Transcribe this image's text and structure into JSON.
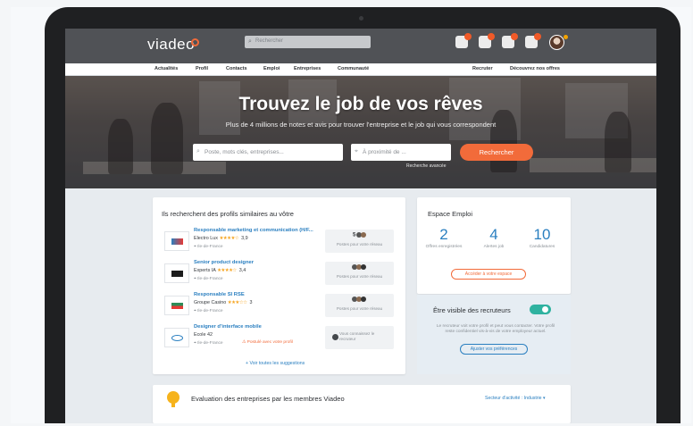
{
  "app": {
    "logo": "viadeo",
    "search_placeholder": "Rechercher"
  },
  "nav": {
    "items": [
      "Actualités",
      "Profil",
      "Contacts",
      "Emploi",
      "Entreprises",
      "Communauté"
    ],
    "right_items": [
      "Recruter",
      "Découvrez nos offres"
    ]
  },
  "hero": {
    "title": "Trouvez le job de vos rêves",
    "subtitle": "Plus de 4 millions de notes et avis pour trouver l'entreprise et le job qui vous correspondent",
    "job_placeholder": "Poste, mots clés, entreprises...",
    "location_placeholder": "À proximité de ...",
    "search_button": "Rechercher",
    "advanced_link": "Recherche avancée"
  },
  "similar": {
    "title": "Ils recherchent des profils similaires au vôtre",
    "rows": [
      {
        "title": "Responsable marketing et communication (H/F...",
        "company": "Electro Lux",
        "stars": "★★★★☆",
        "rating": "3,9",
        "location": "Ile-de-France",
        "box_count": "5",
        "box_text": "Postes pour votre réseau",
        "warning": ""
      },
      {
        "title": "Senior product designer",
        "company": "Experts IA",
        "stars": "★★★★☆",
        "rating": "3,4",
        "location": "Ile-de-France",
        "box_count": "",
        "box_text": "Postes pour votre réseau",
        "warning": ""
      },
      {
        "title": "Responsable SI RSE",
        "company": "Groupe Casino",
        "stars": "★★★☆☆",
        "rating": "3",
        "location": "Ile-de-France",
        "box_count": "",
        "box_text": "Postes pour votre réseau",
        "warning": ""
      },
      {
        "title": "Designer d'interface mobile",
        "company": "Ecole 42",
        "stars": "",
        "rating": "",
        "location": "Ile-de-France",
        "box_count": "",
        "box_text": "Vous connaissez le recruteur",
        "warning": "Postulé avec votre profil"
      }
    ],
    "see_all": "+ Voir toutes les suggestions"
  },
  "espace": {
    "title": "Espace Emploi",
    "stats": [
      {
        "value": "2",
        "label": "Offres enregistrées"
      },
      {
        "value": "4",
        "label": "Alertes job"
      },
      {
        "value": "10",
        "label": "Candidatures"
      }
    ],
    "access_button": "Accéder à votre espace"
  },
  "visibility": {
    "title": "Être visible des recruteurs",
    "text": "Le recruteur voit votre profil et peut vous contacter. Votre profil reste confidentiel vis-à-vis de votre employeur actuel.",
    "button": "Ajuster vos préférences"
  },
  "evaluation": {
    "title": "Evaluation des entreprises par les membres Viadeo",
    "link": "Secteur d'activité : Industrie ▾"
  },
  "colors": {
    "accent": "#f26b3a",
    "link": "#2a7fc0",
    "topbar": "#505256",
    "toggle_on": "#2fb2a0"
  }
}
